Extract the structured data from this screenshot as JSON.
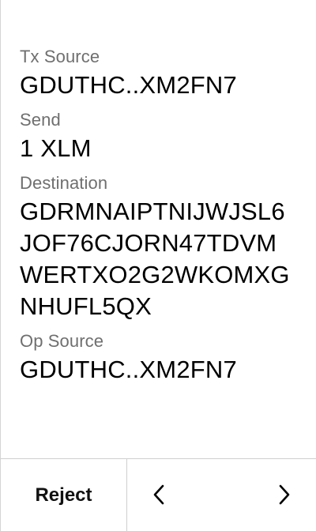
{
  "review": {
    "tx_source": {
      "label": "Tx Source",
      "value": "GDUTHC..XM2FN7"
    },
    "send": {
      "label": "Send",
      "value": "1 XLM"
    },
    "destination": {
      "label": "Destination",
      "value": "GDRMNAIPTNIJWJSL6JOF76CJORN47TDVMWERTXO2G2WKOMXGNHUFL5QX"
    },
    "op_source": {
      "label": "Op Source",
      "value": "GDUTHC..XM2FN7"
    }
  },
  "footer": {
    "reject_label": "Reject",
    "prev_icon": "chevron-left-icon",
    "next_icon": "chevron-right-icon"
  }
}
